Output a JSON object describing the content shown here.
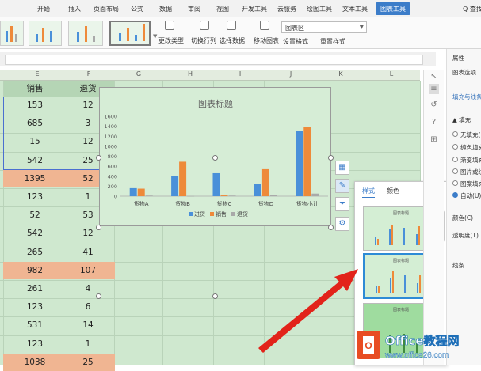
{
  "ribbon": {
    "tabs": [
      "开始",
      "插入",
      "页面布局",
      "公式",
      "数据",
      "审阅",
      "视图",
      "开发工具",
      "云服务",
      "绘图工具",
      "文本工具",
      "图表工具"
    ],
    "active_tab": "图表工具",
    "search_label": "Q 查找",
    "buttons": {
      "change_type": "更改类型",
      "switch_rowcol": "切换行列",
      "select_data": "选择数据",
      "move_chart": "移动图表",
      "set_format": "设置格式",
      "reset_style": "重置样式"
    },
    "element_combo": "图表区"
  },
  "columns": [
    "E",
    "F",
    "G",
    "H",
    "I",
    "J",
    "K",
    "L"
  ],
  "table": {
    "headers": [
      "销售",
      "退货"
    ],
    "rows": [
      {
        "sales": "153",
        "returns": "12",
        "hl": false
      },
      {
        "sales": "685",
        "returns": "3",
        "hl": false
      },
      {
        "sales": "15",
        "returns": "12",
        "hl": false
      },
      {
        "sales": "542",
        "returns": "25",
        "hl": false
      },
      {
        "sales": "1395",
        "returns": "52",
        "hl": true
      },
      {
        "sales": "123",
        "returns": "1",
        "hl": false
      },
      {
        "sales": "52",
        "returns": "53",
        "hl": false
      },
      {
        "sales": "542",
        "returns": "12",
        "hl": false
      },
      {
        "sales": "265",
        "returns": "41",
        "hl": false
      },
      {
        "sales": "982",
        "returns": "107",
        "hl": true
      },
      {
        "sales": "261",
        "returns": "4",
        "hl": false
      },
      {
        "sales": "123",
        "returns": "6",
        "hl": false
      },
      {
        "sales": "531",
        "returns": "14",
        "hl": false
      },
      {
        "sales": "123",
        "returns": "1",
        "hl": false
      },
      {
        "sales": "1038",
        "returns": "25",
        "hl": true
      }
    ]
  },
  "chart_data": {
    "type": "bar",
    "title": "图表标题",
    "categories": [
      "货物A",
      "货物B",
      "货物C",
      "货物D",
      "货物小计"
    ],
    "ylim": [
      0,
      1600
    ],
    "yticks": [
      "0",
      "200",
      "400",
      "600",
      "800",
      "1000",
      "1200",
      "1400",
      "1600"
    ],
    "series": [
      {
        "name": "进货",
        "color": "#4a90d9",
        "values": [
          160,
          410,
          460,
          250,
          1300
        ]
      },
      {
        "name": "销售",
        "color": "#ee8a3a",
        "values": [
          150,
          690,
          15,
          540,
          1390
        ]
      },
      {
        "name": "退货",
        "color": "#a9a9a9",
        "values": [
          12,
          3,
          12,
          25,
          52
        ]
      }
    ],
    "legend": "bottom",
    "grid": false
  },
  "style_panel": {
    "tabs": [
      "样式",
      "颜色"
    ],
    "active_tab": "样式",
    "thumb_titles": [
      "图表标题",
      "图表标题",
      "图表标题"
    ]
  },
  "right_pane": {
    "title": "属性",
    "options_label": "图表选项",
    "fill_line": "填充与线条",
    "fill_section": "▲ 填充",
    "fill_options": [
      "无填充(",
      "纯色填充",
      "渐变填充",
      "图片或纹",
      "图案填充",
      "自动(U)"
    ],
    "color_label": "颜色(C)",
    "transparency_label": "透明度(T)",
    "line_label": "线条"
  },
  "watermark": {
    "brand": "Office教程网",
    "url": "www.office26.com"
  }
}
